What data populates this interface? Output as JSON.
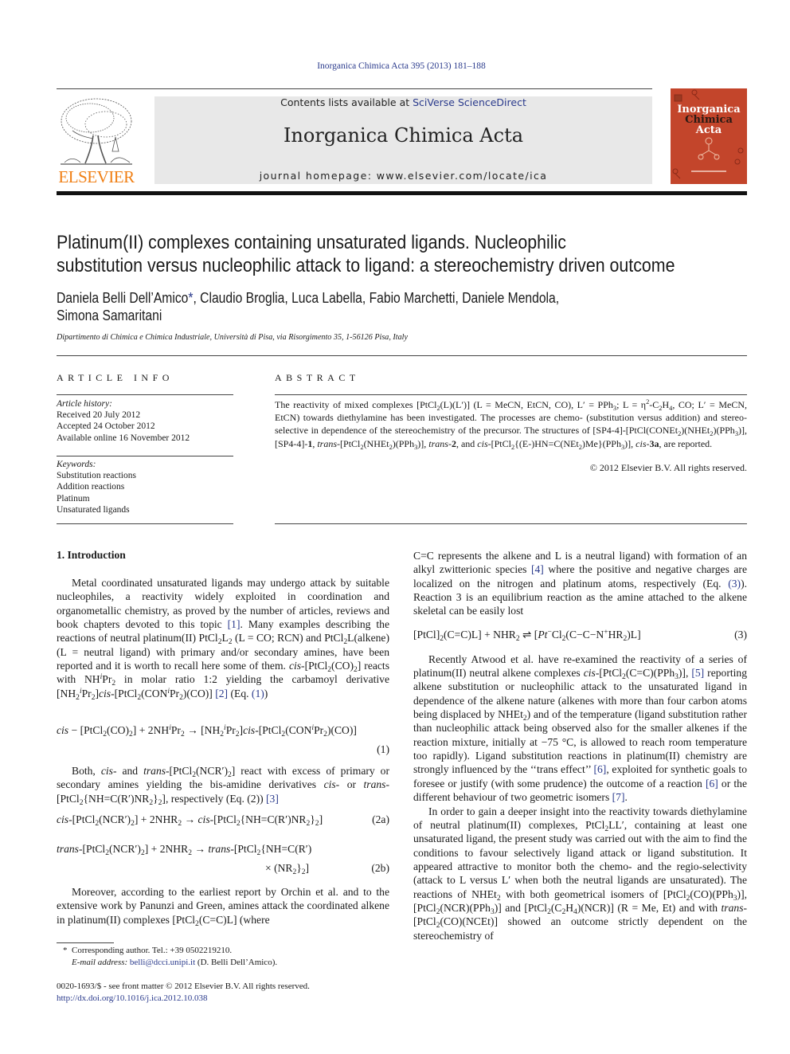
{
  "header": {
    "citation": "Inorganica Chimica Acta 395 (2013) 181–188",
    "contents_prefix": "Contents lists available at ",
    "contents_link": "SciVerse ScienceDirect",
    "journal_name": "Inorganica Chimica Acta",
    "homepage_prefix": "journal homepage: ",
    "homepage_url": "www.elsevier.com/locate/ica",
    "publisher_logo": "ELSEVIER",
    "cover_title_line1": "Inorganica",
    "cover_title_line2a": "Chimica",
    "cover_title_line2b": " Acta",
    "colors": {
      "link": "#2a3a8c",
      "elsevier_orange": "#f07f14",
      "cover_red": "#c3452b",
      "masthead_gray": "#e8e8e8"
    }
  },
  "article": {
    "title_line1": "Platinum(II) complexes containing unsaturated ligands. Nucleophilic",
    "title_line2": "substitution versus nucleophilic attack to ligand: a stereochemistry driven outcome",
    "authors_line1_a": "Daniela Belli Dell’Amico",
    "authors_star": "*",
    "authors_line1_b": ", Claudio Broglia, Luca Labella, Fabio Marchetti, Daniele Mendola,",
    "authors_line2": "Simona Samaritani",
    "affiliation": "Dipartimento di Chimica e Chimica Industriale, Università di Pisa, via Risorgimento 35, 1-56126 Pisa, Italy"
  },
  "article_info": {
    "heading": "ARTICLE INFO",
    "history_label": "Article history:",
    "history": [
      "Received 20 July 2012",
      "Accepted 24 October 2012",
      "Available online 16 November 2012"
    ],
    "keywords_label": "Keywords:",
    "keywords": [
      "Substitution reactions",
      "Addition reactions",
      "Platinum",
      "Unsaturated ligands"
    ]
  },
  "abstract": {
    "heading": "ABSTRACT",
    "copyright": "© 2012 Elsevier B.V. All rights reserved."
  },
  "intro": {
    "heading": "1. Introduction",
    "ref1": "[1]",
    "ref2": "[2]",
    "eq1_ref": "(1)",
    "ref3": "[3]",
    "ref4": "[4]",
    "eq3_ref": "(3)",
    "ref5": "[5]",
    "ref6a": "[6]",
    "ref6b": "[6]",
    "ref7": "[7]",
    "eq1_num": "(1)",
    "eq2a_num": "(2a)",
    "eq2b_num": "(2b)",
    "eq3_num": "(3)"
  },
  "footnotes": {
    "corresponding": "Corresponding author. Tel.: +39 0502219210.",
    "email_label": "E-mail address:",
    "email": "belli@dcci.unipi.it",
    "email_suffix": " (D. Belli Dell’Amico).",
    "front_matter": "0020-1693/$ - see front matter © 2012 Elsevier B.V. All rights reserved.",
    "doi": "http://dx.doi.org/10.1016/j.ica.2012.10.038"
  }
}
